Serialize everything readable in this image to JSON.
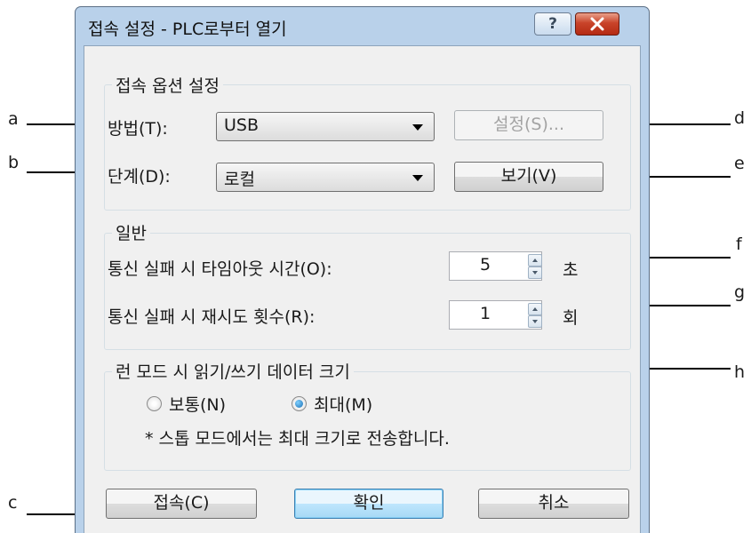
{
  "window": {
    "title": "접속 설정 - PLC로부터 열기",
    "help_glyph": "?",
    "close_glyph": "✕"
  },
  "connection_options": {
    "legend": "접속 옵션 설정",
    "method_label": "방법(T):",
    "method_value": "USB",
    "settings_button": "설정(S)...",
    "level_label": "단계(D):",
    "level_value": "로컬",
    "view_button": "보기(V)"
  },
  "general": {
    "legend": "일반",
    "timeout_label": "통신 실패 시 타임아웃 시간(O):",
    "timeout_value": "5",
    "timeout_unit": "초",
    "retry_label": "통신 실패 시 재시도 횟수(R):",
    "retry_value": "1",
    "retry_unit": "회"
  },
  "run_mode": {
    "legend": "런 모드 시 읽기/쓰기 데이터 크기",
    "normal_label": "보통(N)",
    "normal_selected": false,
    "max_label": "최대(M)",
    "max_selected": true,
    "note": "* 스톱 모드에서는 최대 크기로 전송합니다."
  },
  "buttons": {
    "connect": "접속(C)",
    "ok": "확인",
    "cancel": "취소"
  },
  "callouts": {
    "a": "a",
    "b": "b",
    "c": "c",
    "d": "d",
    "e": "e",
    "f": "f",
    "g": "g",
    "h": "h"
  }
}
